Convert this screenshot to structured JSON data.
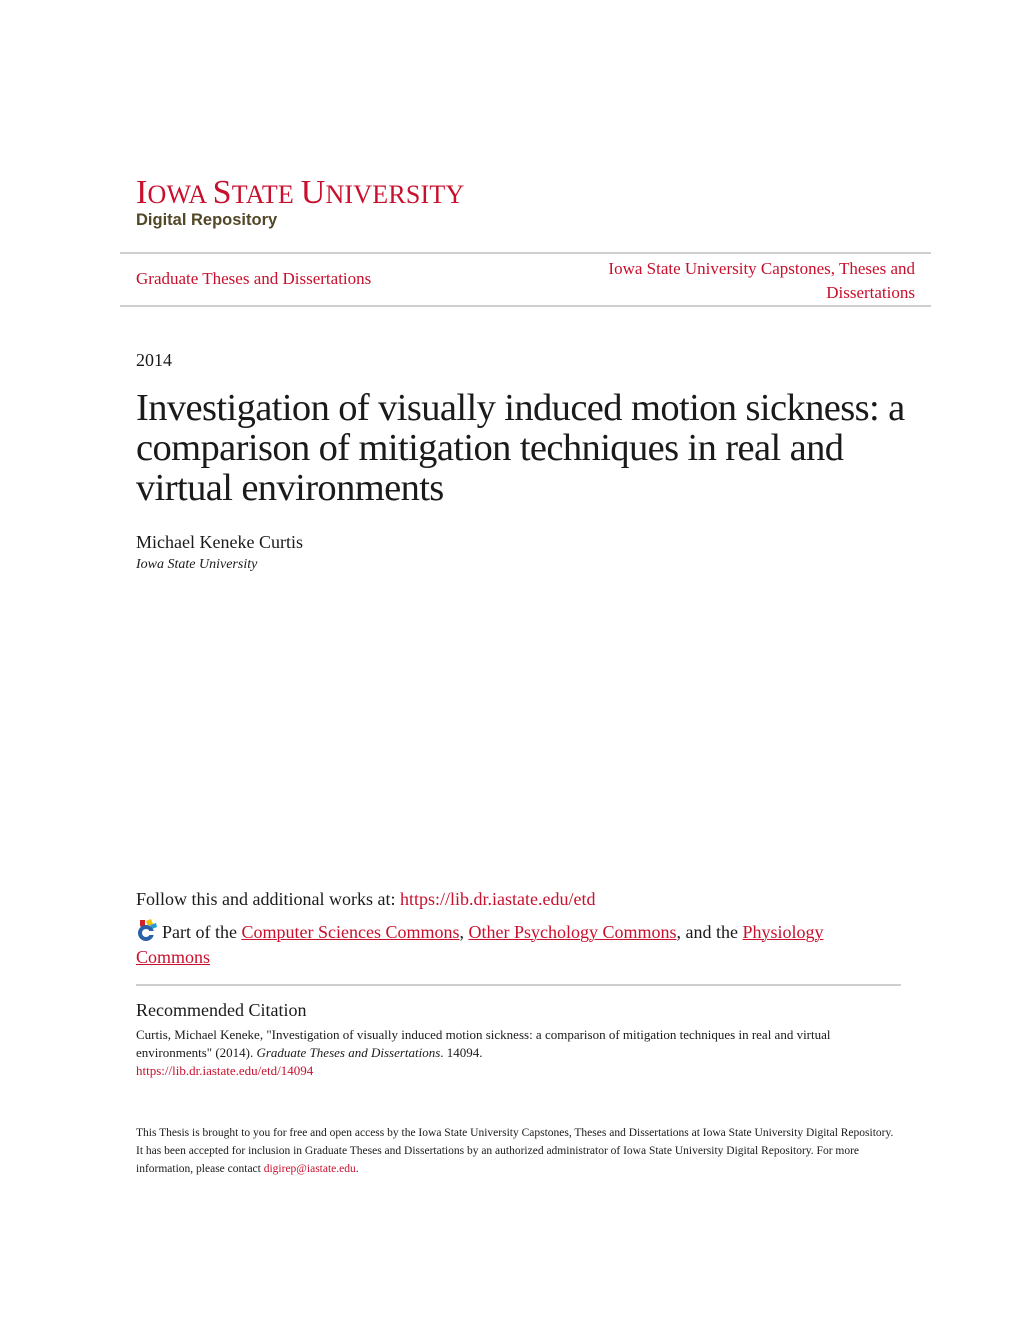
{
  "header": {
    "logo_line1_initial_1": "I",
    "logo_line1_rest_1": "OWA ",
    "logo_line1_initial_2": "S",
    "logo_line1_rest_2": "TATE ",
    "logo_line1_initial_3": "U",
    "logo_line1_rest_3": "NIVERSITY",
    "logo_line2": "Digital Repository",
    "series_left": "Graduate Theses and Dissertations",
    "series_right_line1": "Iowa State University Capstones, Theses and",
    "series_right_line2": "Dissertations"
  },
  "document": {
    "year": "2014",
    "title_line1": "Investigation of visually induced motion sickness: a",
    "title_line2": "comparison of mitigation techniques in real and",
    "title_line3": "virtual environments",
    "author": "Michael Keneke Curtis",
    "affiliation": "Iowa State University"
  },
  "links": {
    "follow_prefix": "Follow this and additional works at: ",
    "follow_url": "https://lib.dr.iastate.edu/etd",
    "part_of_prefix": "Part of the ",
    "commons_1": "Computer Sciences Commons",
    "sep_1": ", ",
    "commons_2": "Other Psychology Commons",
    "sep_2": ", and the ",
    "commons_3": "Physiology Commons"
  },
  "citation": {
    "heading": "Recommended Citation",
    "text_1": "Curtis, Michael Keneke, \"Investigation of visually induced motion sickness: a comparison of mitigation techniques in real and virtual environments\" (2014). ",
    "series_italic": "Graduate Theses and Dissertations",
    "text_2": ". 14094.",
    "url": "https://lib.dr.iastate.edu/etd/14094"
  },
  "footer": {
    "text_1": "This Thesis is brought to you for free and open access by the Iowa State University Capstones, Theses and Dissertations at Iowa State University Digital Repository. It has been accepted for inclusion in Graduate Theses and Dissertations by an authorized administrator of Iowa State University Digital Repository. For more information, please contact ",
    "email": "digirep@iastate.edu",
    "text_2": "."
  },
  "colors": {
    "brand_red": "#c8102e",
    "brand_brown": "#524727",
    "rule_gray": "#cfcfcf"
  },
  "icons": {
    "bepress": "bepress-commons-network-icon"
  }
}
